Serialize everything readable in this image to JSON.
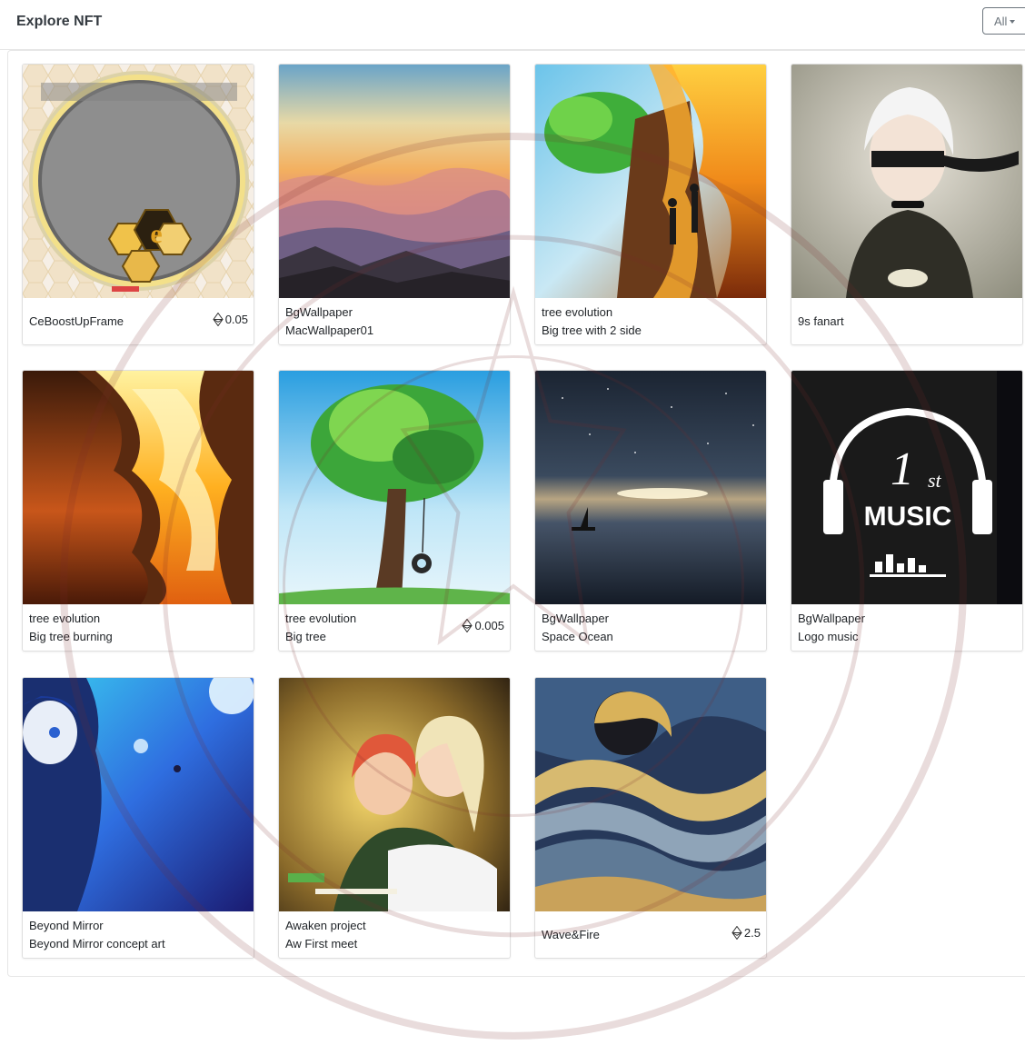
{
  "header": {
    "title": "Explore NFT",
    "filter": {
      "selected": "All"
    }
  },
  "colors": {
    "border": "#dfdfdf",
    "text": "#212529",
    "filter_border": "#6c757d"
  },
  "cards": [
    {
      "title": "CeBoostUpFrame",
      "subtitle": "",
      "price": "0.05",
      "image": "honeycomb-frame"
    },
    {
      "title": "BgWallpaper",
      "subtitle": "MacWallpaper01",
      "price": "",
      "image": "sunset-mountains"
    },
    {
      "title": "tree evolution",
      "subtitle": "Big tree with 2 side",
      "price": "",
      "image": "tree-fire-half"
    },
    {
      "title": "9s fanart",
      "subtitle": "",
      "price": "",
      "image": "anime-white-hair"
    },
    {
      "title": "tree evolution",
      "subtitle": "Big tree burning",
      "price": "",
      "image": "tree-burning"
    },
    {
      "title": "tree evolution",
      "subtitle": "Big tree",
      "price": "0.005",
      "image": "tree-swing"
    },
    {
      "title": "BgWallpaper",
      "subtitle": "Space Ocean",
      "price": "",
      "image": "space-ocean"
    },
    {
      "title": "BgWallpaper",
      "subtitle": "Logo music",
      "price": "",
      "image": "music-logo"
    },
    {
      "title": "Beyond Mirror",
      "subtitle": "Beyond Mirror concept art",
      "price": "",
      "image": "anime-blue"
    },
    {
      "title": "Awaken project",
      "subtitle": "Aw First meet",
      "price": "",
      "image": "anime-couple"
    },
    {
      "title": "Wave&Fire",
      "subtitle": "",
      "price": "2.5",
      "image": "wave-fire"
    }
  ]
}
